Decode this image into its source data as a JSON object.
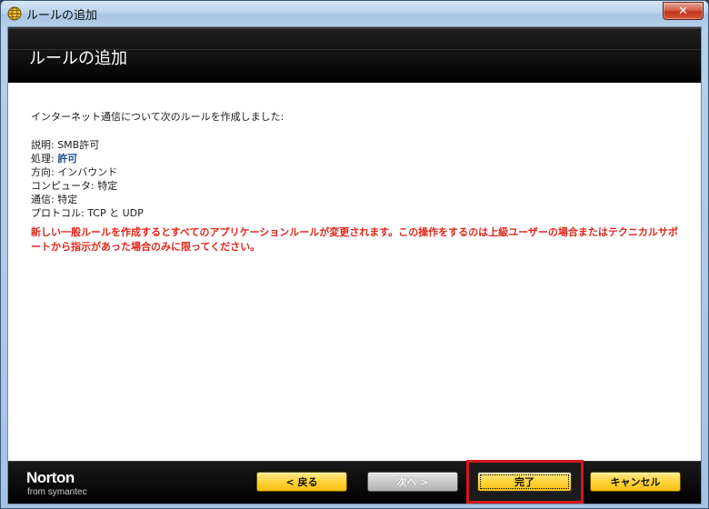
{
  "window": {
    "title": "ルールの追加",
    "close_glyph": "✕"
  },
  "banner": {
    "title": "ルールの追加"
  },
  "content": {
    "intro": "インターネット通信について次のルールを作成しました:",
    "details": [
      {
        "label": "説明: ",
        "value": "SMB許可"
      },
      {
        "label": "処理: ",
        "value": "許可"
      },
      {
        "label": "方向: ",
        "value": "インバウンド"
      },
      {
        "label": "コンピュータ: ",
        "value": "特定"
      },
      {
        "label": "通信: ",
        "value": "特定"
      },
      {
        "label": "プロトコル: ",
        "value": "TCP と UDP"
      }
    ],
    "warning": "新しい一般ルールを作成するとすべてのアプリケーションルールが変更されます。この操作をするのは上級ユーザーの場合またはテクニカルサポートから指示があった場合のみに限ってください。"
  },
  "footer": {
    "logo_word": "Norton",
    "logo_sub": "from symantec",
    "back_label": "< 戻る",
    "next_label": "次へ >",
    "finish_label": "完了",
    "cancel_label": "キャンセル"
  },
  "colors": {
    "warning": "#e0261a",
    "action_value": "#1b4a8a",
    "button": "#ffd43b",
    "highlight": "#d6141e",
    "banner": "#111111"
  },
  "icons": {
    "app": "globe-icon",
    "close": "close-icon"
  }
}
